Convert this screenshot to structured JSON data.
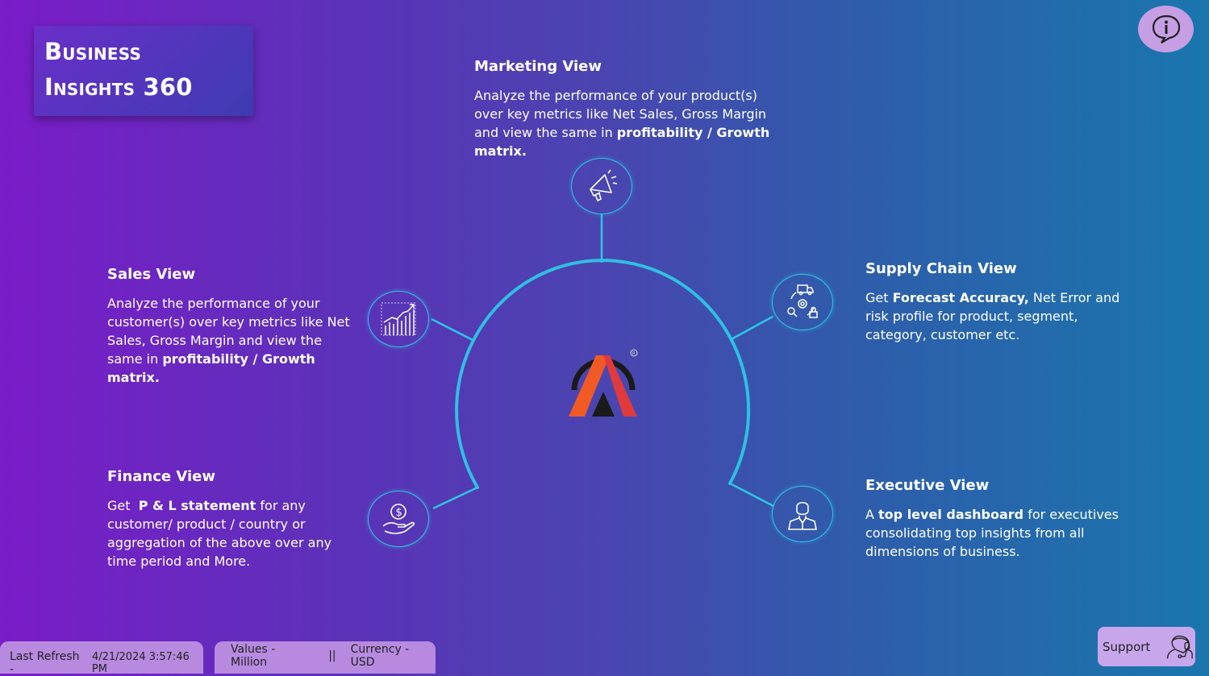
{
  "title": {
    "line1": "Business",
    "line2": "Insights 360"
  },
  "sections": {
    "marketing": {
      "heading": "Marketing View",
      "text1": "Analyze the performance of your product(s) over key metrics like Net Sales, Gross Margin and view the same in ",
      "bold1": "profitability / Growth matrix."
    },
    "sales": {
      "heading": "Sales View",
      "text1": "Analyze the performance of your customer(s) over key metrics like Net Sales, Gross Margin and view the same in ",
      "bold1": "profitability / Growth matrix."
    },
    "supply": {
      "heading": "Supply Chain View",
      "text1": "Get ",
      "bold1": "Forecast Accuracy,",
      "text2": " Net Error and risk profile for product, segment, category, customer etc."
    },
    "finance": {
      "heading": "Finance View",
      "text1": "Get  ",
      "bold1": "P & L statement",
      "text2": " for any customer/ product / country or aggregation of the above over any time period and More."
    },
    "executive": {
      "heading": "Executive View",
      "text1": "A ",
      "bold1": "top level dashboard",
      "text2": " for executives consolidating top insights from all dimensions of business."
    }
  },
  "footer": {
    "refresh_label": "Last Refresh -",
    "refresh_value": "4/21/2024 3:57:46 PM",
    "values_label": "Values - Million",
    "separator": "||",
    "currency_label": "Currency - USD"
  },
  "support": {
    "label": "Support"
  },
  "icons": {
    "info": "info-icon",
    "marketing": "megaphone-icon",
    "sales": "growth-chart-icon",
    "supply": "supply-chain-icon",
    "finance": "money-hand-icon",
    "executive": "executive-icon",
    "support": "headset-icon",
    "logo": "atliq-logo"
  },
  "colors": {
    "accent_ring": "#2ec6e4",
    "footer_pill": "#b78ae0",
    "info_button": "#c59ee4",
    "logo_orange": "#f15a24",
    "logo_red": "#e03a3e"
  }
}
